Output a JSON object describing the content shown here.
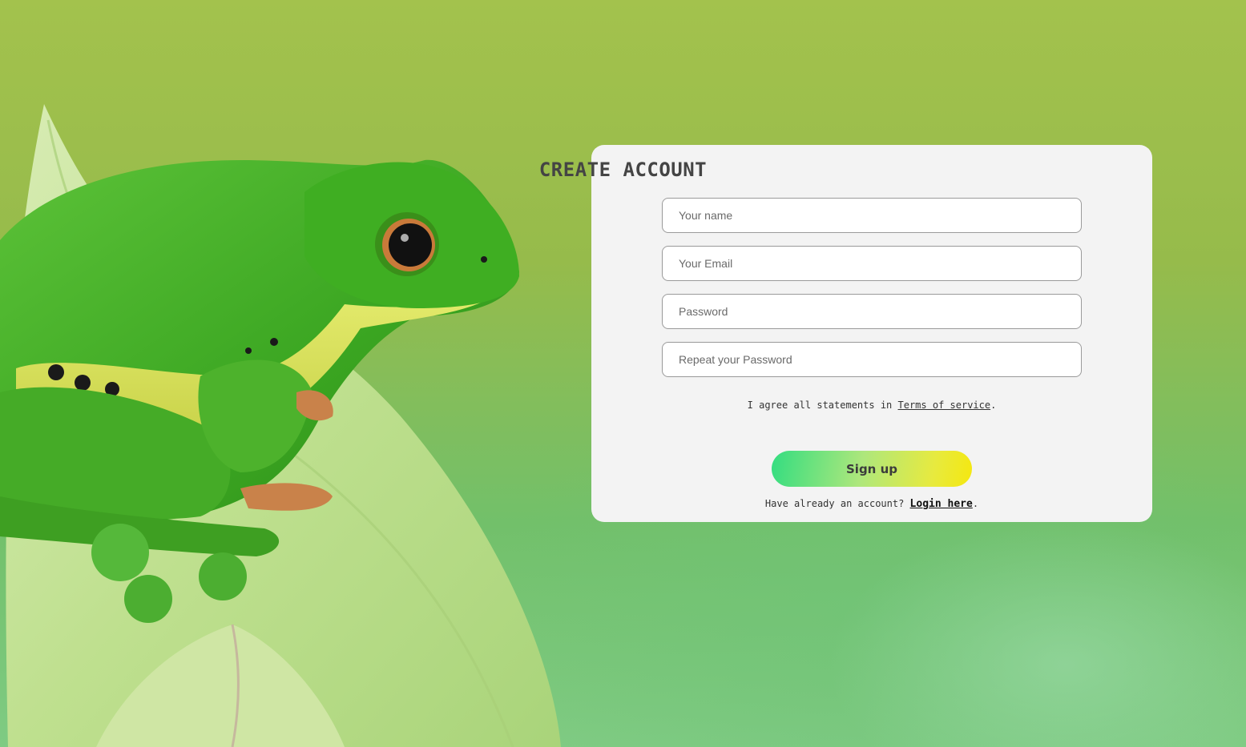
{
  "form": {
    "title": "CREATE ACCOUNT",
    "fields": [
      {
        "placeholder": "Your name",
        "value": ""
      },
      {
        "placeholder": "Your Email",
        "value": ""
      },
      {
        "placeholder": "Password",
        "value": ""
      },
      {
        "placeholder": "Repeat your Password",
        "value": ""
      }
    ],
    "terms_prefix": "I agree all statements in ",
    "terms_link": "Terms of service",
    "terms_suffix": ".",
    "signup_label": "Sign up",
    "login_prefix": "Have already an account? ",
    "login_link": "Login here",
    "login_suffix": "."
  },
  "colors": {
    "card_background": "#f3f3f3",
    "button_gradient_start": "#33dd80",
    "button_gradient_end": "#f5e80f",
    "title_text": "#444444"
  },
  "background": {
    "image_subject": "green tree frog on lotus bud"
  }
}
